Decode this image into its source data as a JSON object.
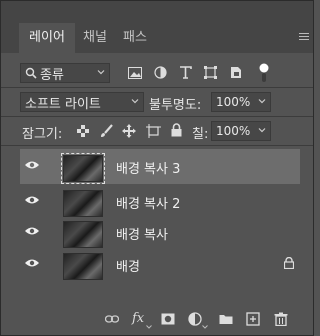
{
  "tabs": [
    "레이어",
    "채널",
    "패스"
  ],
  "filter": {
    "label": "종류"
  },
  "blend": {
    "mode": "소프트 라이트",
    "opacity_label": "불투명도:",
    "opacity": "100%"
  },
  "lock": {
    "label": "잠그기:",
    "fill_label": "칠:",
    "fill": "100%"
  },
  "layers": [
    {
      "name": "배경 복사 3",
      "selected": true
    },
    {
      "name": "배경 복사 2"
    },
    {
      "name": "배경 복사"
    },
    {
      "name": "배경",
      "locked": true
    }
  ],
  "bottom": {
    "fx": "fx"
  },
  "colors": {
    "panel": "#535353",
    "tabbar": "#454545",
    "selected": "#6d6d6d"
  }
}
